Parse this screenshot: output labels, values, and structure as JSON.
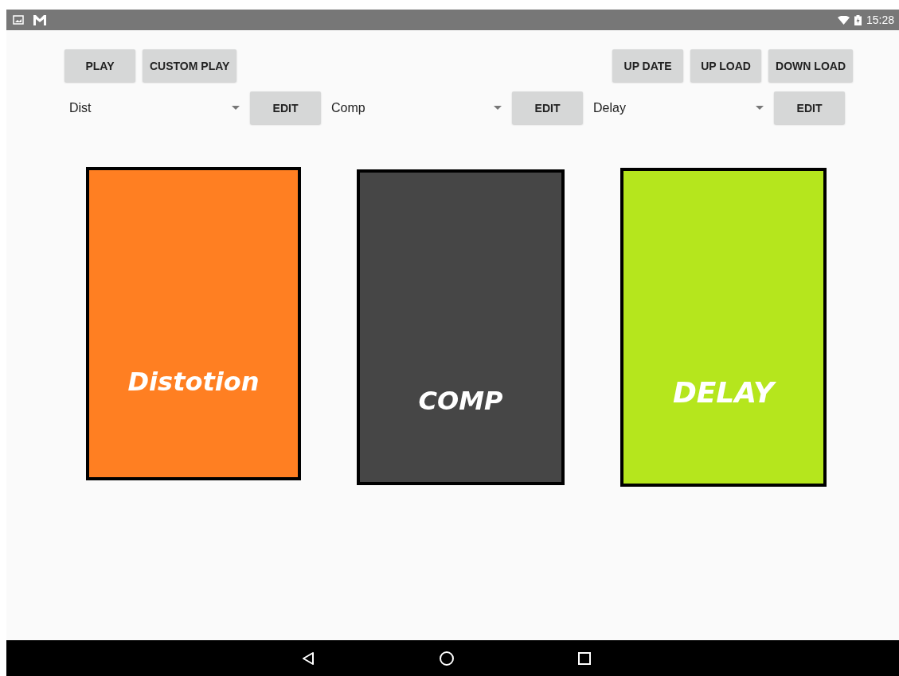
{
  "status_bar": {
    "time": "15:28"
  },
  "top_buttons_left": [
    "PLAY",
    "CUSTOM PLAY"
  ],
  "top_buttons_right": [
    "UP DATE",
    "UP LOAD",
    "DOWN LOAD"
  ],
  "effect_slots": [
    {
      "value": "Dist",
      "button": "EDIT"
    },
    {
      "value": "Comp",
      "button": "EDIT"
    },
    {
      "value": "Delay",
      "button": "EDIT"
    }
  ],
  "pedals": [
    {
      "label": "Distotion",
      "color": "#ff7f22"
    },
    {
      "label": "COMP",
      "color": "#464646"
    },
    {
      "label": "DELAY",
      "color": "#b5e61d"
    }
  ]
}
